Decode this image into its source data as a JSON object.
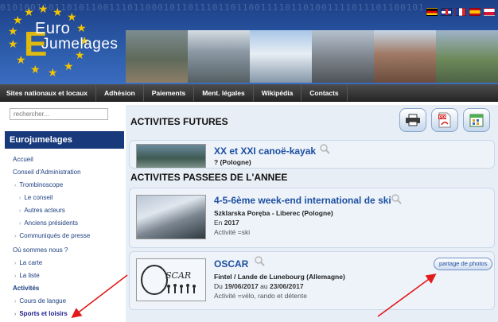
{
  "banner": {
    "binary_text": "0101001101101011001110110001011011101101100111101101001111011101100101",
    "logo_line1": "Euro",
    "logo_line2": "Jumelages",
    "logo_letter": "E",
    "flags": [
      "flag-de",
      "flag-en",
      "flag-fr",
      "flag-es",
      "flag-pl"
    ],
    "star_color": "#f2c400"
  },
  "nav": {
    "items": [
      "Sites nationaux et locaux",
      "Adhésion",
      "Paiements",
      "Ment. légales",
      "Wikipédia",
      "Contacts"
    ]
  },
  "sidebar": {
    "search_placeholder": "rechercher...",
    "title": "Eurojumelages",
    "items": [
      {
        "label": "Accueil"
      },
      {
        "label": "Conseil d'Administration"
      },
      {
        "label": "Trombinoscope"
      },
      {
        "label": "Le conseil"
      },
      {
        "label": "Autres acteurs"
      },
      {
        "label": "Anciens présidents"
      },
      {
        "label": "Communiqués de presse"
      },
      {
        "label": "Où sommes nous ?"
      },
      {
        "label": "La carte"
      },
      {
        "label": "La liste"
      },
      {
        "label": "Activités"
      },
      {
        "label": "Cours de langue"
      },
      {
        "label": "Sports et loisirs"
      }
    ]
  },
  "main": {
    "tools": [
      "print-icon",
      "pdf-icon",
      "calendar-icon"
    ],
    "future_title": "ACTIVITES FUTURES",
    "past_title": "ACTIVITES PASSEES DE L'ANNEE",
    "future_event": {
      "title": "XX et XXI canoë-kayak",
      "location": "? (Pologne)"
    },
    "events": [
      {
        "title": "4-5-6ème week-end international de ski",
        "location": "Szklarska Poręba - Liberec (Pologne)",
        "date_prefix": "En",
        "date": "2017",
        "type": "Activité =ski"
      },
      {
        "title": "OSCAR",
        "location": "Fintel / Lande de Lunebourg (Allemagne)",
        "date_prefix": "Du",
        "date_start": "19/06/2017",
        "date_mid": "au",
        "date_end": "23/06/2017",
        "type": "Activité =vélo, rando et détente",
        "share_label": "partage de photos"
      }
    ],
    "arrow_color": "#e11a1a",
    "title_color": "#1c4fa0"
  }
}
